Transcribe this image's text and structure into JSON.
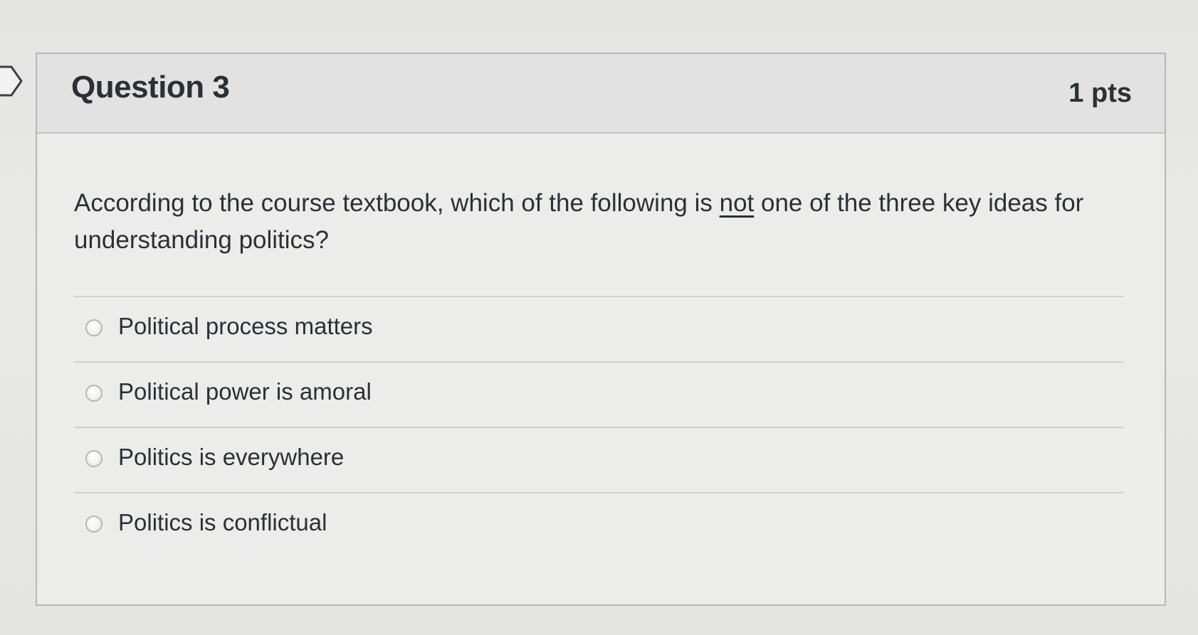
{
  "question": {
    "title": "Question 3",
    "points": "1 pts",
    "text_before": "According to the course textbook, which of the following is ",
    "text_emphasis": "not",
    "text_after": " one of the three key ideas for understanding politics?"
  },
  "answers": [
    {
      "label": "Political process matters",
      "selected": false
    },
    {
      "label": "Political power is amoral",
      "selected": false
    },
    {
      "label": "Politics is everywhere",
      "selected": false
    },
    {
      "label": "Politics is conflictual",
      "selected": false
    }
  ],
  "colors": {
    "text": "#2b3036",
    "header_bg": "#e1e2e1",
    "card_bg": "#ececea",
    "border": "#b6b8b7"
  }
}
